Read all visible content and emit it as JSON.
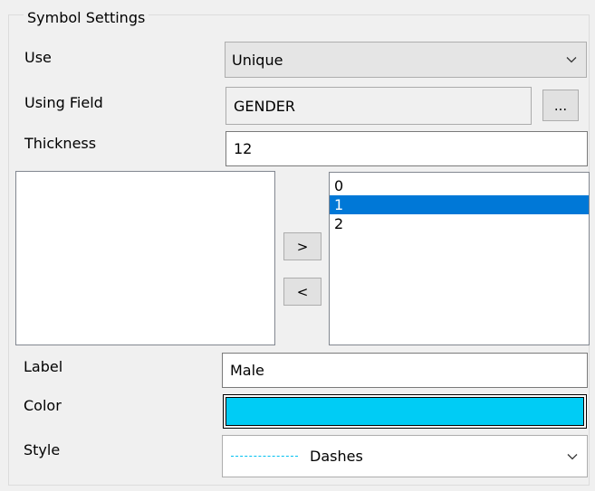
{
  "group": {
    "title": "Symbol Settings"
  },
  "use": {
    "label": "Use",
    "value": "Unique"
  },
  "using_field": {
    "label": "Using Field",
    "value": "GENDER",
    "browse_label": "..."
  },
  "thickness": {
    "label": "Thickness",
    "value": "12"
  },
  "transfer": {
    "right_label": ">",
    "left_label": "<"
  },
  "right_list": {
    "items": [
      "0",
      "1",
      "2"
    ],
    "selected_index": 1
  },
  "label_field": {
    "label": "Label",
    "value": "Male"
  },
  "color_field": {
    "label": "Color",
    "swatch_color": "#00ccf5"
  },
  "style_field": {
    "label": "Style",
    "value": "Dashes",
    "line_color": "#00c0f0"
  },
  "colors": {
    "selection": "#0078d7",
    "background": "#f0f0f0"
  },
  "icons": {
    "dropdown": "chevron-down-icon"
  }
}
